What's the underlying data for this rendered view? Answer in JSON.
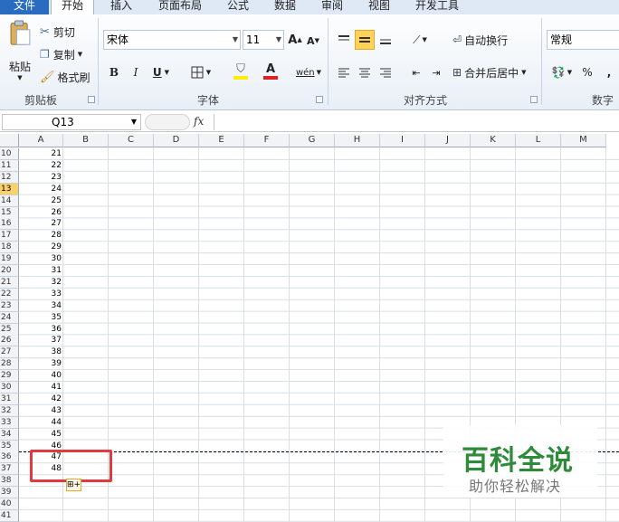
{
  "tabs": [
    {
      "label": "文件"
    },
    {
      "label": "开始"
    },
    {
      "label": "插入"
    },
    {
      "label": "页面布局"
    },
    {
      "label": "公式"
    },
    {
      "label": "数据"
    },
    {
      "label": "审阅"
    },
    {
      "label": "视图"
    },
    {
      "label": "开发工具"
    }
  ],
  "clipboard": {
    "paste": "粘贴",
    "cut": "剪切",
    "copy": "复制",
    "format_painter": "格式刷",
    "group_label": "剪贴板"
  },
  "font": {
    "name": "宋体",
    "size": "11",
    "group_label": "字体",
    "bold": "B",
    "italic": "I",
    "underline": "U",
    "grow": "A",
    "shrink": "A",
    "font_color_letter": "A",
    "wen": "wén"
  },
  "alignment": {
    "wrap_text": "自动换行",
    "merge_center": "合并后居中",
    "group_label": "对齐方式"
  },
  "number": {
    "format": "常规",
    "group_label": "数字",
    "percent": "%",
    "comma": ","
  },
  "formula_bar": {
    "name_box": "Q13",
    "fx": "fx",
    "formula": ""
  },
  "columns": [
    "A",
    "B",
    "C",
    "D",
    "E",
    "F",
    "G",
    "H",
    "I",
    "J",
    "K",
    "L",
    "M"
  ],
  "rows": [
    {
      "num": "10",
      "a": "21"
    },
    {
      "num": "11",
      "a": "22"
    },
    {
      "num": "12",
      "a": "23"
    },
    {
      "num": "13",
      "a": "24"
    },
    {
      "num": "14",
      "a": "25"
    },
    {
      "num": "15",
      "a": "26"
    },
    {
      "num": "16",
      "a": "27"
    },
    {
      "num": "17",
      "a": "28"
    },
    {
      "num": "18",
      "a": "29"
    },
    {
      "num": "19",
      "a": "30"
    },
    {
      "num": "20",
      "a": "31"
    },
    {
      "num": "21",
      "a": "32"
    },
    {
      "num": "22",
      "a": "33"
    },
    {
      "num": "23",
      "a": "34"
    },
    {
      "num": "24",
      "a": "35"
    },
    {
      "num": "25",
      "a": "36"
    },
    {
      "num": "26",
      "a": "37"
    },
    {
      "num": "27",
      "a": "38"
    },
    {
      "num": "28",
      "a": "39"
    },
    {
      "num": "29",
      "a": "40"
    },
    {
      "num": "30",
      "a": "41"
    },
    {
      "num": "31",
      "a": "42"
    },
    {
      "num": "32",
      "a": "43"
    },
    {
      "num": "33",
      "a": "44"
    },
    {
      "num": "34",
      "a": "45"
    },
    {
      "num": "35",
      "a": "46"
    },
    {
      "num": "36",
      "a": "47"
    },
    {
      "num": "37",
      "a": "48"
    },
    {
      "num": "38",
      "a": ""
    },
    {
      "num": "39",
      "a": ""
    },
    {
      "num": "40",
      "a": ""
    },
    {
      "num": "41",
      "a": ""
    }
  ],
  "selected_row": "13",
  "colors": {
    "accent": "#2a6cc0",
    "highlight_box": "#e0393e",
    "watermark_red": "#d9302c",
    "watermark_green": "#2e8b3a",
    "font_color_bar": "#e02020",
    "fill_color_bar": "#ffee00"
  },
  "watermark": {
    "line1": "百科全说",
    "line2": "助你轻松解决"
  }
}
